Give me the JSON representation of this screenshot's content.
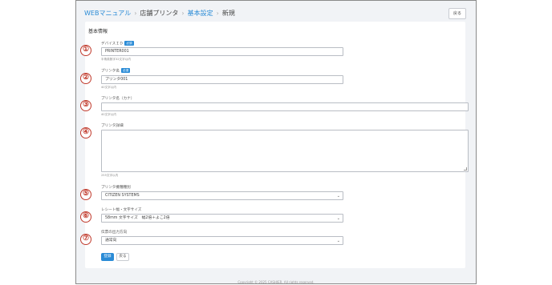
{
  "breadcrumb": {
    "items": [
      {
        "label": "WEBマニュアル"
      },
      {
        "label": "店舗プリンタ"
      },
      {
        "label": "基本設定"
      },
      {
        "label": "新規"
      }
    ]
  },
  "header": {
    "back_label": "戻る"
  },
  "card": {
    "title": "基本情報"
  },
  "fields": {
    "device_id": {
      "label": "デバイスＩＤ",
      "badge": "必須",
      "value": "PRINTER001",
      "hint": "半角英数字32文字以内"
    },
    "printer_name": {
      "label": "プリンタ名",
      "badge": "必須",
      "value": "プリンタ001",
      "hint": "40文字以内"
    },
    "printer_name_kana": {
      "label": "プリンタ名（カナ）",
      "value": "",
      "hint": "40文字以内"
    },
    "printer_detail": {
      "label": "プリンタ詳細",
      "value": "",
      "hint": "255文字以内"
    },
    "printer_model": {
      "label": "プリンタ機種種別",
      "selected": "CITIZEN SYSTEMS"
    },
    "receipt_width": {
      "label": "レシート幅・文字サイズ",
      "selected": "58mm 文字サイズ　幅2倍＋よこ2倍"
    },
    "slip_direction": {
      "label": "伝票の出力方向",
      "selected": "通常向"
    }
  },
  "buttons": {
    "register": "登録",
    "back": "戻る"
  },
  "footer": {
    "copyright": "Copyright © 2025 CASHIER. All rights reserved."
  },
  "markers": [
    "①",
    "②",
    "③",
    "④",
    "⑤",
    "⑥",
    "⑦"
  ],
  "colors": {
    "accent": "#2a8bd6",
    "marker": "#c0392b"
  }
}
